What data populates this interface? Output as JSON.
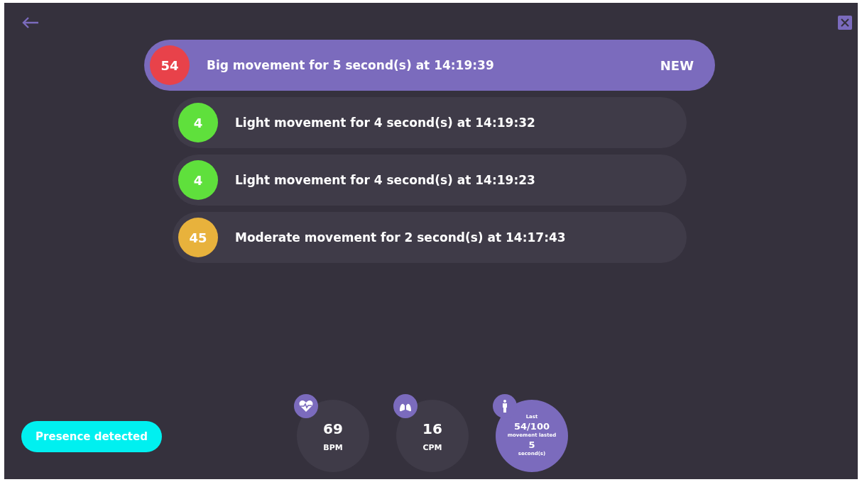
{
  "events": [
    {
      "score": "54",
      "color": "#e8424a",
      "text": "Big movement for 5 second(s) at 14:19:39",
      "highlighted": true,
      "badge": "NEW"
    },
    {
      "score": "4",
      "color": "#5fe03c",
      "text": "Light movement for 4 second(s) at 14:19:32",
      "highlighted": false
    },
    {
      "score": "4",
      "color": "#5fe03c",
      "text": "Light movement for 4 second(s) at 14:19:23",
      "highlighted": false
    },
    {
      "score": "45",
      "color": "#e8b23c",
      "text": "Moderate movement for 2 second(s) at 14:17:43",
      "highlighted": false
    }
  ],
  "presence": {
    "label": "Presence detected"
  },
  "stats": [
    {
      "kind": "heart",
      "value": "69",
      "unit": "BPM"
    },
    {
      "kind": "lungs",
      "value": "16",
      "unit": "CPM"
    },
    {
      "kind": "movement",
      "lines": [
        "Last",
        "54/100",
        "movement lasted",
        "5",
        "second(s)"
      ]
    }
  ]
}
